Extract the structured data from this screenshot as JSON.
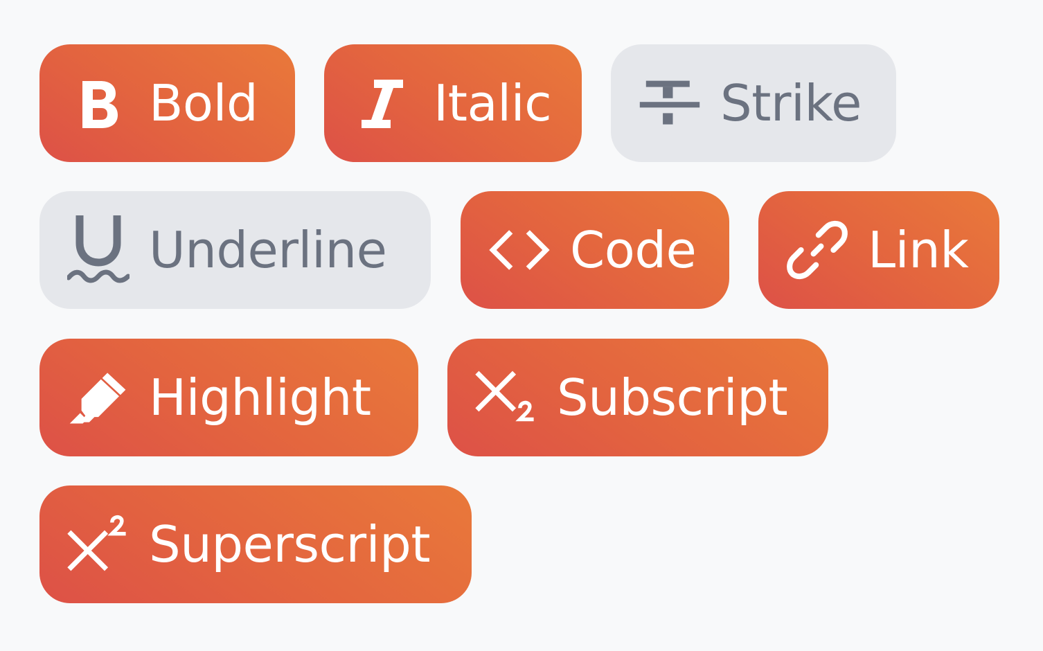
{
  "toolbar": {
    "buttons": [
      {
        "id": "bold",
        "label": "Bold",
        "icon": "bold-icon",
        "active": true
      },
      {
        "id": "italic",
        "label": "Italic",
        "icon": "italic-icon",
        "active": true
      },
      {
        "id": "strike",
        "label": "Strike",
        "icon": "strikethrough-icon",
        "active": false
      },
      {
        "id": "underline",
        "label": "Underline",
        "icon": "underline-icon",
        "active": false
      },
      {
        "id": "code",
        "label": "Code",
        "icon": "code-icon",
        "active": true
      },
      {
        "id": "link",
        "label": "Link",
        "icon": "link-icon",
        "active": true
      },
      {
        "id": "highlight",
        "label": "Highlight",
        "icon": "highlighter-icon",
        "active": true
      },
      {
        "id": "subscript",
        "label": "Subscript",
        "icon": "subscript-icon",
        "active": true
      },
      {
        "id": "superscript",
        "label": "Superscript",
        "icon": "superscript-icon",
        "active": true
      }
    ]
  },
  "colors": {
    "page_background": "#f8f9fa",
    "active_gradient_start": "#dd5147",
    "active_gradient_end": "#e9793a",
    "active_text": "#ffffff",
    "inactive_background": "#e5e7eb",
    "inactive_text": "#6b7280"
  }
}
